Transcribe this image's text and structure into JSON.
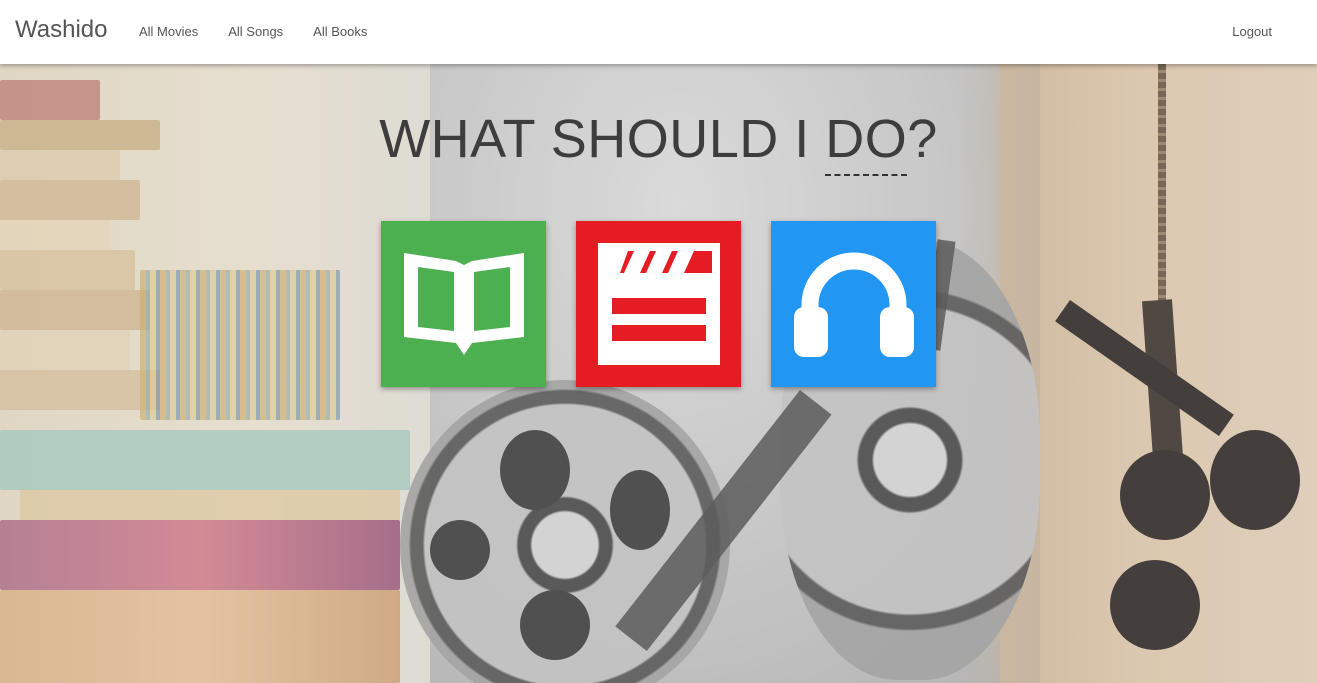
{
  "navbar": {
    "brand": "Washido",
    "links": [
      {
        "label": "All Movies"
      },
      {
        "label": "All Songs"
      },
      {
        "label": "All Books"
      }
    ],
    "logout_label": "Logout"
  },
  "hero": {
    "title_prefix": "WHAT SHOULD I ",
    "title_highlight": "DO",
    "title_suffix": "?"
  },
  "tiles": [
    {
      "name": "books",
      "icon": "open-book-icon",
      "color": "#4caf50"
    },
    {
      "name": "movies",
      "icon": "clapperboard-icon",
      "color": "#e51c23"
    },
    {
      "name": "songs",
      "icon": "headphones-icon",
      "color": "#2196f3"
    }
  ],
  "colors": {
    "navbar_bg": "#ffffff",
    "nav_text": "#555555",
    "title_text": "#3d3d3d"
  }
}
